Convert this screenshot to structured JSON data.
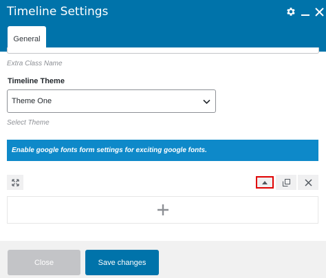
{
  "window": {
    "title": "Timeline Settings",
    "icons": [
      "gear-icon",
      "minimize-icon",
      "close-icon"
    ]
  },
  "tabs": [
    {
      "label": "General",
      "active": true
    }
  ],
  "form": {
    "extra_class_hint": "Extra Class Name",
    "theme_label": "Timeline Theme",
    "theme_value": "Theme One",
    "theme_hint": "Select Theme",
    "notice": "Enable google fonts form settings for exciting google fonts."
  },
  "row_controls": {
    "icons": [
      "expand-icon",
      "move-up-icon",
      "duplicate-icon",
      "delete-icon"
    ]
  },
  "add_area": {
    "icon": "plus-icon"
  },
  "footer": {
    "close_label": "Close",
    "save_label": "Save changes"
  },
  "colors": {
    "header": "#0073aa",
    "notice": "#0e89c9",
    "save_button": "#0073aa",
    "close_button": "#c3c4c7",
    "highlight_border": "#e00000"
  }
}
